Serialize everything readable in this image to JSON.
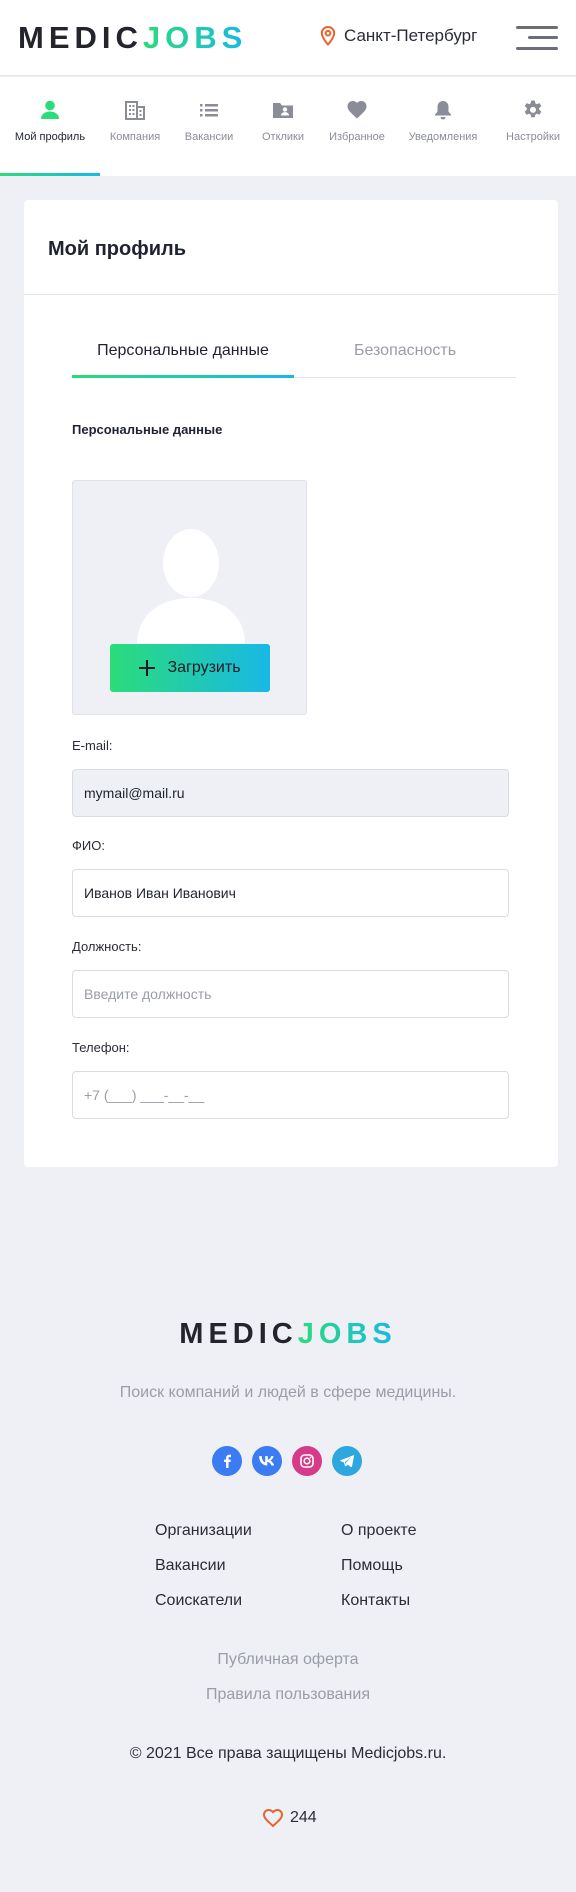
{
  "header": {
    "logo_part1": "MEDIC",
    "logo_part2": "JOBS",
    "city": "Санкт-Петербург",
    "accent_orange": "#e8642c"
  },
  "nav": {
    "items": [
      {
        "label": "Мой профиль",
        "icon": "person-icon",
        "active": true
      },
      {
        "label": "Компания",
        "icon": "building-icon",
        "active": false
      },
      {
        "label": "Вакансии",
        "icon": "list-icon",
        "active": false
      },
      {
        "label": "Отклики",
        "icon": "folder-user-icon",
        "active": false
      },
      {
        "label": "Избранное",
        "icon": "heart-icon",
        "active": false
      },
      {
        "label": "Уведомления",
        "icon": "bell-icon",
        "active": false
      },
      {
        "label": "Настройки",
        "icon": "gear-icon",
        "active": false
      }
    ]
  },
  "profile": {
    "title": "Мой профиль",
    "tabs": [
      "Персональные данные",
      "Безопасность"
    ],
    "section_title": "Персональные данные",
    "upload_label": "Загрузить",
    "email_label": "E-mail:",
    "email_value": "mymail@mail.ru",
    "fio_label": "ФИО:",
    "fio_value": "Иванов Иван Иванович",
    "position_label": "Должность:",
    "position_placeholder": "Введите должность",
    "phone_label": "Телефон:",
    "phone_placeholder": "+7 (___) ___-__-__"
  },
  "footer": {
    "logo_part1": "MEDIC",
    "logo_part2": "JOBS",
    "tagline": "Поиск компаний и людей в сфере медицины.",
    "socials": [
      {
        "name": "facebook-icon",
        "glyph": "f",
        "color": "#3b7cf2"
      },
      {
        "name": "vk-icon",
        "glyph": "vk",
        "color": "#3b7cf2"
      },
      {
        "name": "instagram-icon",
        "glyph": "◎",
        "color": "#d63b8a"
      },
      {
        "name": "telegram-icon",
        "glyph": "➤",
        "color": "#2ea6de"
      }
    ],
    "links_left": [
      "Организации",
      "Вакансии",
      "Соискатели"
    ],
    "links_right": [
      "О проекте",
      "Помощь",
      "Контакты"
    ],
    "offer": "Публичная оферта",
    "rules": "Правила пользования",
    "copyright": "© 2021 Все права защищены Medicjobs.ru.",
    "likes": "244"
  }
}
